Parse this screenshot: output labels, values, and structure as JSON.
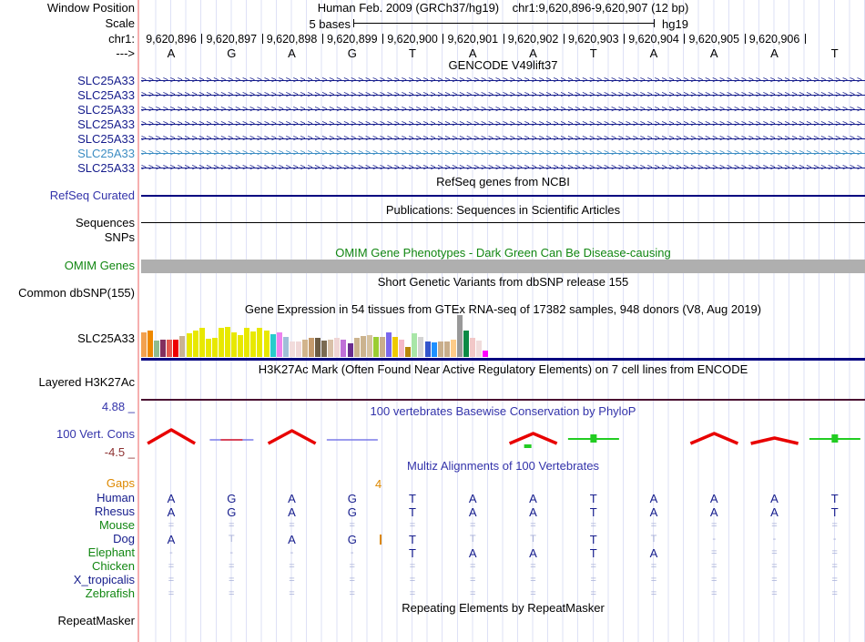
{
  "header": {
    "window_position_label": "Window Position",
    "assembly_text": "Human Feb. 2009 (GRCh37/hg19)",
    "position_text": "chr1:9,620,896-9,620,907 (12 bp)",
    "scale_label": "Scale",
    "scale_value": "5 bases",
    "scale_assembly": "hg19",
    "chrom_label": "chr1:",
    "strand_label": "--->",
    "coordinates": [
      "9,620,896",
      "9,620,897",
      "9,620,898",
      "9,620,899",
      "9,620,900",
      "9,620,901",
      "9,620,902",
      "9,620,903",
      "9,620,904",
      "9,620,905",
      "9,620,906"
    ],
    "bases": [
      "A",
      "G",
      "A",
      "G",
      "T",
      "A",
      "A",
      "T",
      "A",
      "A",
      "A",
      "T"
    ]
  },
  "tracks": {
    "gencode": {
      "title": "GENCODE V49lift37",
      "rows": [
        {
          "label": "SLC25A33",
          "color": "#151C8C"
        },
        {
          "label": "SLC25A33",
          "color": "#151C8C"
        },
        {
          "label": "SLC25A33",
          "color": "#151C8C"
        },
        {
          "label": "SLC25A33",
          "color": "#151C8C"
        },
        {
          "label": "SLC25A33",
          "color": "#151C8C"
        },
        {
          "label": "SLC25A33",
          "color": "#3D8DC3"
        },
        {
          "label": "SLC25A33",
          "color": "#151C8C"
        }
      ]
    },
    "refseq": {
      "title": "RefSeq genes from NCBI",
      "label": "RefSeq Curated",
      "line_color": "#000080"
    },
    "publications": {
      "title": "Publications: Sequences in Scientific Articles",
      "label": "Sequences",
      "line_color": "#000000"
    },
    "snps": {
      "label": "SNPs"
    },
    "omim": {
      "title": "OMIM Gene Phenotypes - Dark Green Can Be Disease-causing",
      "label": "OMIM Genes",
      "bar_color": "#AFAFAF"
    },
    "dbsnp": {
      "title": "Short Genetic Variants from dbSNP release 155",
      "label": "Common dbSNP(155)"
    },
    "gtex": {
      "title": "Gene Expression in 54 tissues from GTEx RNA-seq of 17382 samples, 948 donors (V8, Aug 2019)",
      "label": "SLC25A33",
      "baseline_color": "#000080",
      "bars": [
        {
          "c": "#F2A14F",
          "h": 0.58
        },
        {
          "c": "#EE8800",
          "h": 0.63
        },
        {
          "c": "#8FBC8F",
          "h": 0.39
        },
        {
          "c": "#83305F",
          "h": 0.42
        },
        {
          "c": "#E4584E",
          "h": 0.42
        },
        {
          "c": "#EE0000",
          "h": 0.42
        },
        {
          "c": "#C9B393",
          "h": 0.5
        },
        {
          "c": "#E8E800",
          "h": 0.57
        },
        {
          "c": "#E8E800",
          "h": 0.63
        },
        {
          "c": "#E8E800",
          "h": 0.7
        },
        {
          "c": "#E8E800",
          "h": 0.43
        },
        {
          "c": "#E8E800",
          "h": 0.45
        },
        {
          "c": "#E8E800",
          "h": 0.7
        },
        {
          "c": "#E8E800",
          "h": 0.72
        },
        {
          "c": "#E8E800",
          "h": 0.58
        },
        {
          "c": "#E8E800",
          "h": 0.52
        },
        {
          "c": "#E8E800",
          "h": 0.7
        },
        {
          "c": "#E8E800",
          "h": 0.61
        },
        {
          "c": "#E8E800",
          "h": 0.7
        },
        {
          "c": "#E8E800",
          "h": 0.63
        },
        {
          "c": "#28CCCC",
          "h": 0.54
        },
        {
          "c": "#EE82EE",
          "h": 0.59
        },
        {
          "c": "#9FBFD8",
          "h": 0.48
        },
        {
          "c": "#F2DCDC",
          "h": 0.37
        },
        {
          "c": "#F0D8D8",
          "h": 0.37
        },
        {
          "c": "#D2B48C",
          "h": 0.42
        },
        {
          "c": "#C49A6C",
          "h": 0.45
        },
        {
          "c": "#6B5B43",
          "h": 0.45
        },
        {
          "c": "#7A6A52",
          "h": 0.39
        },
        {
          "c": "#D8C0A8",
          "h": 0.42
        },
        {
          "c": "#EFD5D5",
          "h": 0.45
        },
        {
          "c": "#C070D8",
          "h": 0.42
        },
        {
          "c": "#6A2D8F",
          "h": 0.33
        },
        {
          "c": "#CBB38E",
          "h": 0.45
        },
        {
          "c": "#CBB38E",
          "h": 0.5
        },
        {
          "c": "#D6C2A0",
          "h": 0.52
        },
        {
          "c": "#9ACD32",
          "h": 0.48
        },
        {
          "c": "#C9AE8C",
          "h": 0.48
        },
        {
          "c": "#7B68EE",
          "h": 0.59
        },
        {
          "c": "#EEC900",
          "h": 0.48
        },
        {
          "c": "#F4B8C8",
          "h": 0.42
        },
        {
          "c": "#B8860B",
          "h": 0.24
        },
        {
          "c": "#A8E6A8",
          "h": 0.57
        },
        {
          "c": "#D3D3D3",
          "h": 0.48
        },
        {
          "c": "#3355CC",
          "h": 0.37
        },
        {
          "c": "#1E90FF",
          "h": 0.35
        },
        {
          "c": "#C9AE8C",
          "h": 0.37
        },
        {
          "c": "#C9AE8C",
          "h": 0.37
        },
        {
          "c": "#FFCC88",
          "h": 0.42
        },
        {
          "c": "#999999",
          "h": 1.0
        },
        {
          "c": "#0A8A45",
          "h": 0.63
        },
        {
          "c": "#F2C8C8",
          "h": 0.45
        },
        {
          "c": "#F0DCDC",
          "h": 0.39
        },
        {
          "c": "#FF00FF",
          "h": 0.16
        }
      ]
    },
    "h3k27ac": {
      "title": "H3K27Ac Mark (Often Found Near Active Regulatory Elements) on 7 cell lines from ENCODE",
      "label": "Layered H3K27Ac",
      "line_color": "#4A1030"
    },
    "conservation": {
      "title": "100 vertebrates Basewise Conservation by PhyloP",
      "label": "100 Vert. Cons",
      "max_label": "4.88 _",
      "min_label": "-4.5 _",
      "pos_color": "#E80000",
      "neutral_color": "#7A7AE8",
      "indel_color": "#22CC22",
      "features": [
        {
          "col": 1,
          "type": "hill",
          "h": 15
        },
        {
          "col": 2,
          "type": "flat_mixed"
        },
        {
          "col": 3,
          "type": "hill",
          "h": 14
        },
        {
          "col": 4,
          "type": "flat_blue"
        },
        {
          "col": 7,
          "type": "hill",
          "h": 11,
          "tick": true
        },
        {
          "col": 8,
          "type": "green_line"
        },
        {
          "col": 10,
          "type": "hill",
          "h": 11
        },
        {
          "col": 11,
          "type": "hill",
          "h": 6
        },
        {
          "col": 12,
          "type": "green_line"
        }
      ]
    },
    "multiz": {
      "title": "Multiz Alignments of 100 Vertebrates",
      "gaps_label": "Gaps",
      "gap_count": "4",
      "rows": [
        {
          "label": "Human",
          "label_color": "#151C8C",
          "cells": [
            "A",
            "G",
            "A",
            "G",
            "T",
            "A",
            "A",
            "T",
            "A",
            "A",
            "A",
            "T"
          ],
          "dim": [
            0,
            0,
            0,
            0,
            0,
            0,
            0,
            0,
            0,
            0,
            0,
            0
          ]
        },
        {
          "label": "Rhesus",
          "label_color": "#151C8C",
          "cells": [
            "A",
            "G",
            "A",
            "G",
            "T",
            "A",
            "A",
            "T",
            "A",
            "A",
            "A",
            "T"
          ],
          "dim": [
            0,
            0,
            0,
            0,
            0,
            0,
            0,
            0,
            0,
            0,
            0,
            0
          ]
        },
        {
          "label": "Mouse",
          "label_color": "#128712",
          "cells": [
            "=",
            "=",
            "=",
            "=",
            "=",
            "=",
            "=",
            "=",
            "=",
            "=",
            "=",
            "="
          ],
          "dim": [
            1,
            1,
            1,
            1,
            1,
            1,
            1,
            1,
            1,
            1,
            1,
            1
          ]
        },
        {
          "label": "Dog",
          "label_color": "#151C8C",
          "cells": [
            "A",
            "T",
            "A",
            "G",
            "T",
            "T",
            "T",
            "T",
            "T",
            "-",
            "-",
            "-"
          ],
          "dim": [
            0,
            1,
            0,
            0,
            0,
            1,
            1,
            0,
            1,
            1,
            1,
            1
          ],
          "insert_after_col": 4
        },
        {
          "label": "Elephant",
          "label_color": "#128712",
          "cells": [
            "-",
            "-",
            "-",
            "-",
            "T",
            "A",
            "A",
            "T",
            "A",
            "=",
            "=",
            "="
          ],
          "dim": [
            1,
            1,
            1,
            1,
            0,
            0,
            0,
            0,
            0,
            1,
            1,
            1
          ]
        },
        {
          "label": "Chicken",
          "label_color": "#128712",
          "cells": [
            "=",
            "=",
            "=",
            "=",
            "=",
            "=",
            "=",
            "=",
            "=",
            "=",
            "=",
            "="
          ],
          "dim": [
            1,
            1,
            1,
            1,
            1,
            1,
            1,
            1,
            1,
            1,
            1,
            1
          ]
        },
        {
          "label": "X_tropicalis",
          "label_color": "#151C8C",
          "cells": [
            "=",
            "=",
            "=",
            "=",
            "=",
            "=",
            "=",
            "=",
            "=",
            "=",
            "=",
            "="
          ],
          "dim": [
            1,
            1,
            1,
            1,
            1,
            1,
            1,
            1,
            1,
            1,
            1,
            1
          ]
        },
        {
          "label": "Zebrafish",
          "label_color": "#128712",
          "cells": [
            "=",
            "=",
            "=",
            "=",
            "=",
            "=",
            "=",
            "=",
            "=",
            "=",
            "=",
            "="
          ],
          "dim": [
            1,
            1,
            1,
            1,
            1,
            1,
            1,
            1,
            1,
            1,
            1,
            1
          ]
        }
      ]
    },
    "repeatmasker": {
      "title": "Repeating Elements by RepeatMasker",
      "label": "RepeatMasker"
    }
  }
}
